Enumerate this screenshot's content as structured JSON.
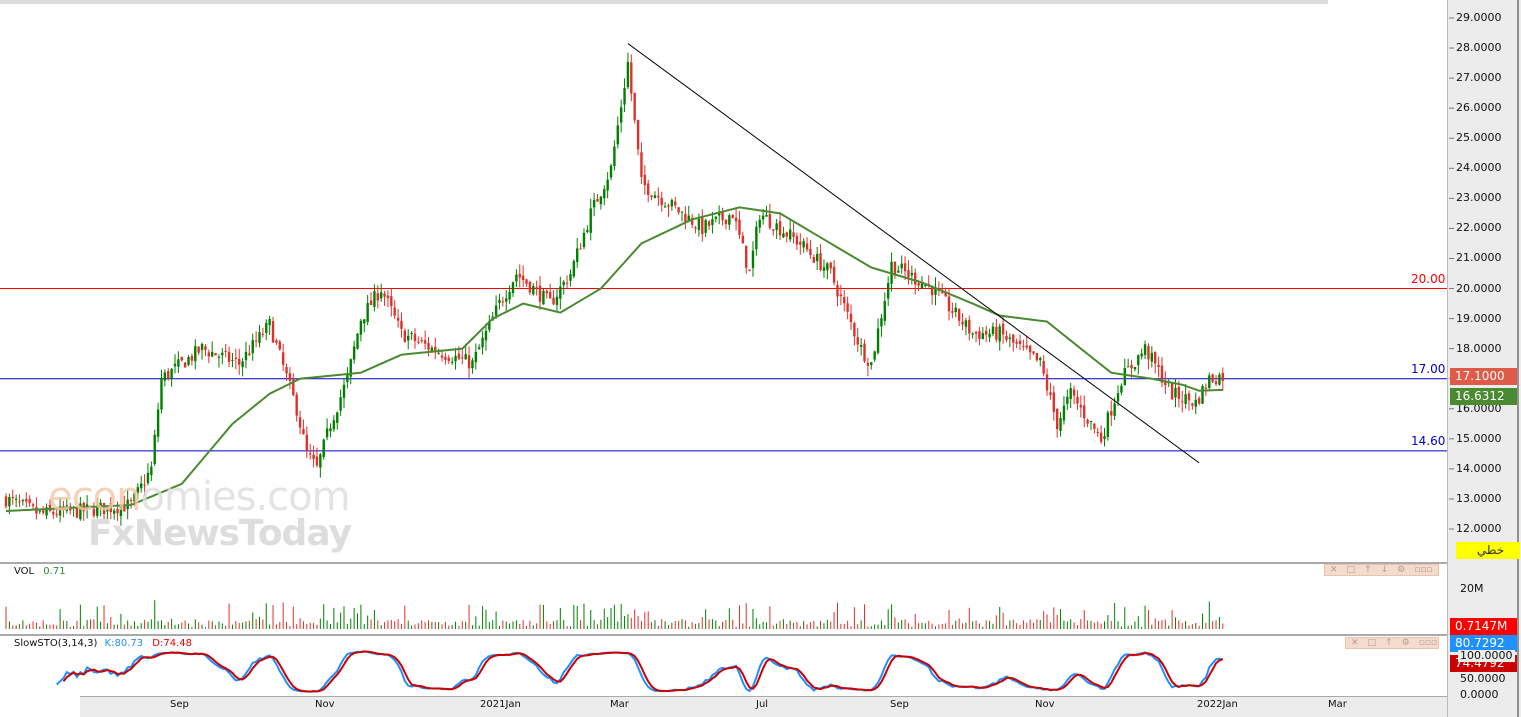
{
  "watermark": {
    "line1": "economies.com",
    "line2": "FxNewsToday"
  },
  "levels": [
    {
      "price": 20.0,
      "label": "20.00",
      "color": "#ff0000"
    },
    {
      "price": 17.0,
      "label": "17.00",
      "color": "#0000cc"
    },
    {
      "price": 14.6,
      "label": "14.60",
      "color": "#0000cc"
    }
  ],
  "price_axis": [
    "29.0000",
    "28.0000",
    "27.0000",
    "26.0000",
    "25.0000",
    "24.0000",
    "23.0000",
    "22.0000",
    "21.0000",
    "20.0000",
    "19.0000",
    "18.0000",
    "17.0000",
    "16.0000",
    "15.0000",
    "14.0000",
    "13.0000",
    "12.0000"
  ],
  "tags": {
    "last_price": "17.1000",
    "ma_value": "16.6312",
    "chart_type": "خطي",
    "volume": "0.7147M",
    "k": "80.7292",
    "d": "74.4792"
  },
  "volume_panel": {
    "title": "VOL",
    "value": "0.71",
    "axis": "20M"
  },
  "stoch_panel": {
    "title": "SlowSTO(3,14,3)",
    "k_label": "K:80.73",
    "d_label": "D:74.48",
    "axis": [
      "100.0000",
      "50.0000",
      "0.0000"
    ]
  },
  "dates": [
    "Sep",
    "Nov",
    "2021Jan",
    "Mar",
    "Jul",
    "Sep",
    "Nov",
    "2022Jan",
    "Mar"
  ],
  "colors": {
    "up": "#008000",
    "down": "#e0302a",
    "ma": "#4a8a30",
    "k": "#1e90ff",
    "d": "#cc0000"
  },
  "chart_data": {
    "type": "candlestick",
    "price_path": [
      [
        0,
        13.0
      ],
      [
        10,
        12.5
      ],
      [
        22,
        12.6
      ],
      [
        37,
        12.8
      ],
      [
        43,
        14
      ],
      [
        46,
        17
      ],
      [
        58,
        18
      ],
      [
        69,
        17.5
      ],
      [
        78,
        18.8
      ],
      [
        86,
        16
      ],
      [
        89,
        14.5
      ],
      [
        92,
        14
      ],
      [
        96,
        15.5
      ],
      [
        101,
        17
      ],
      [
        105,
        19
      ],
      [
        111,
        20
      ],
      [
        117,
        18.5
      ],
      [
        126,
        18
      ],
      [
        138,
        17.5
      ],
      [
        146,
        19.5
      ],
      [
        151,
        20.5
      ],
      [
        161,
        19.5
      ],
      [
        167,
        20.5
      ],
      [
        173,
        22.5
      ],
      [
        179,
        24
      ],
      [
        184,
        27.5
      ],
      [
        188,
        23.5
      ],
      [
        194,
        23
      ],
      [
        206,
        22
      ],
      [
        215,
        22.5
      ],
      [
        220,
        20.5
      ],
      [
        223,
        22.5
      ],
      [
        235,
        21.5
      ],
      [
        244,
        20.5
      ],
      [
        253,
        18
      ],
      [
        256,
        17.5
      ],
      [
        262,
        20.8
      ],
      [
        274,
        20
      ],
      [
        286,
        18.5
      ],
      [
        294,
        18.5
      ],
      [
        306,
        17.5
      ],
      [
        311,
        15.5
      ],
      [
        315,
        16.5
      ],
      [
        324,
        15
      ],
      [
        330,
        17
      ],
      [
        337,
        18
      ],
      [
        345,
        16.5
      ],
      [
        352,
        16.2
      ],
      [
        356,
        17
      ],
      [
        360,
        17.1
      ]
    ],
    "ma_path": [
      [
        0,
        12.6
      ],
      [
        37,
        12.8
      ],
      [
        52,
        13.5
      ],
      [
        67,
        15.5
      ],
      [
        78,
        16.5
      ],
      [
        87,
        17
      ],
      [
        105,
        17.2
      ],
      [
        117,
        17.8
      ],
      [
        135,
        18
      ],
      [
        144,
        19
      ],
      [
        153,
        19.5
      ],
      [
        164,
        19.2
      ],
      [
        176,
        20
      ],
      [
        188,
        21.5
      ],
      [
        203,
        22.3
      ],
      [
        217,
        22.7
      ],
      [
        229,
        22.5
      ],
      [
        244,
        21.5
      ],
      [
        256,
        20.7
      ],
      [
        271,
        20.2
      ],
      [
        286,
        19.5
      ],
      [
        294,
        19.1
      ],
      [
        308,
        18.9
      ],
      [
        318,
        18
      ],
      [
        327,
        17.2
      ],
      [
        339,
        17
      ],
      [
        348,
        16.8
      ],
      [
        353,
        16.6
      ],
      [
        360,
        16.63
      ]
    ],
    "trendline": [
      [
        184,
        28.15
      ],
      [
        353,
        14.2
      ]
    ],
    "ylim": [
      11.4,
      29.6
    ]
  }
}
